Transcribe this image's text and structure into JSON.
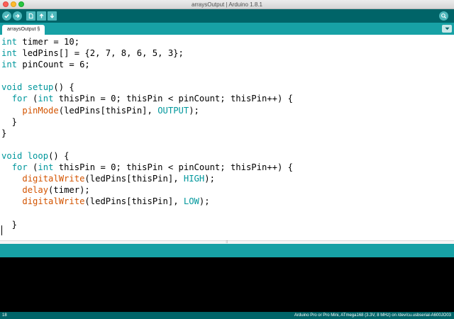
{
  "window": {
    "title": "arraysOutput | Arduino 1.8.1"
  },
  "toolbar": {
    "buttons": [
      {
        "name": "verify",
        "icon": "checkmark-icon"
      },
      {
        "name": "upload",
        "icon": "arrow-right-icon"
      },
      {
        "name": "new",
        "icon": "new-file-icon"
      },
      {
        "name": "open",
        "icon": "arrow-up-icon"
      },
      {
        "name": "save",
        "icon": "arrow-down-icon"
      },
      {
        "name": "serial-monitor",
        "icon": "magnifier-icon"
      }
    ]
  },
  "tabs": [
    {
      "label": "arraysOutput §"
    }
  ],
  "editor": {
    "lines": [
      "int timer = 10;",
      "int ledPins[] = {2, 7, 8, 6, 5, 3};",
      "int pinCount = 6;",
      "",
      "void setup() {",
      "  for (int thisPin = 0; thisPin < pinCount; thisPin++) {",
      "    pinMode(ledPins[thisPin], OUTPUT);",
      "  }",
      "}",
      "",
      "void loop() {",
      "  for (int thisPin = 0; thisPin < pinCount; thisPin++) {",
      "    digitalWrite(ledPins[thisPin], HIGH);",
      "    delay(timer);",
      "    digitalWrite(ledPins[thisPin], LOW);",
      "",
      "  }"
    ]
  },
  "status": {
    "line_number": "18",
    "board": "Arduino Pro or Pro Mini, ATmega168 (3.3V, 8 MHz) on /dev/cu.usbserial-A600JO03"
  },
  "colors": {
    "toolbar": "#006468",
    "tabbar": "#17a1a5",
    "button": "#4db7bb",
    "keyword": "#00979c",
    "function": "#d35400",
    "console": "#000000"
  }
}
